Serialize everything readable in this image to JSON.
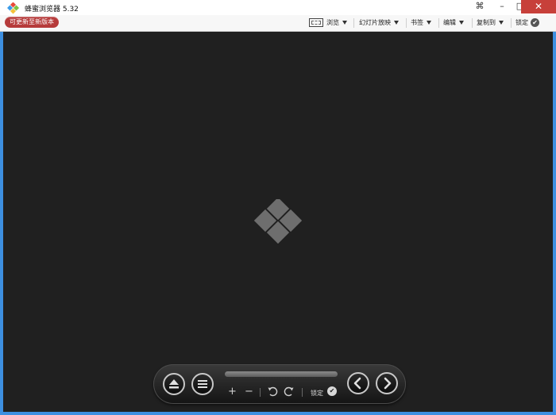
{
  "window": {
    "title": "蜂蜜浏览器 5.32",
    "pin_glyph": "⌘",
    "minimize_glyph": "–",
    "maximize_glyph": "□",
    "close_glyph": "✕"
  },
  "toolbar": {
    "update_badge": "可更新至新版本",
    "menus": {
      "view": "浏览",
      "slideshow": "幻灯片放映",
      "bookmarks": "书签",
      "edit": "编辑",
      "copy_to": "复制到",
      "lock": "锁定"
    },
    "check_glyph": "✔"
  },
  "controls": {
    "zoom_in": "+",
    "zoom_out": "−",
    "lock_label": "锁定",
    "check_glyph": "✔"
  },
  "colors": {
    "viewer_bg": "#202020",
    "frame_accent": "#3d8fe0",
    "close_button": "#c7403a",
    "update_badge": "#b63b3b"
  },
  "icons": [
    "app-logo-icon",
    "pin-icon",
    "view-frame-icon",
    "check-circle-icon",
    "eject-icon",
    "menu-lines-icon",
    "rotate-left-icon",
    "rotate-right-icon",
    "prev-arrow-icon",
    "next-arrow-icon"
  ]
}
